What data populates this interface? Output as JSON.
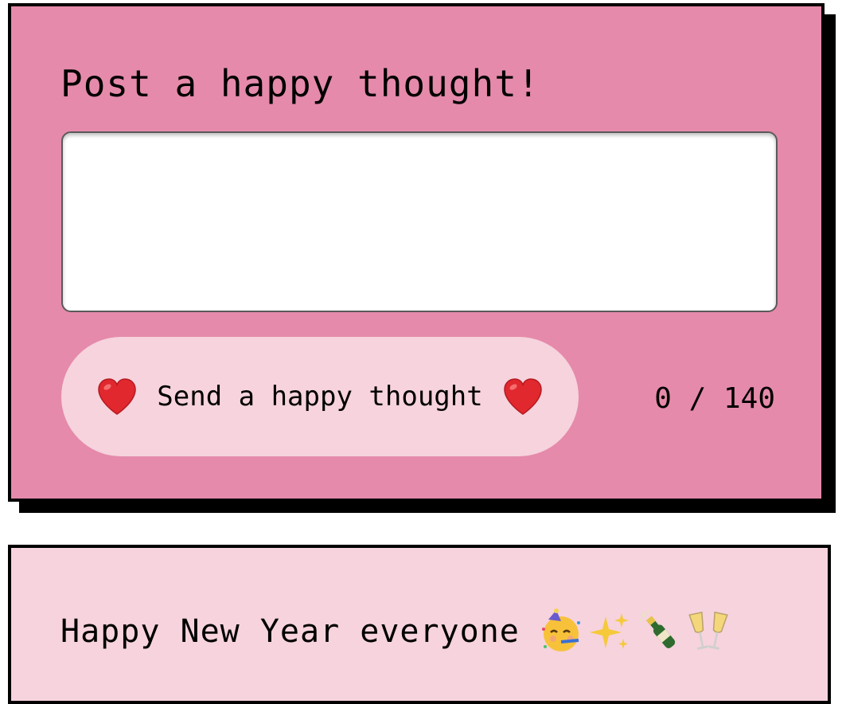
{
  "composer": {
    "title": "Post a happy thought!",
    "input": {
      "value": "",
      "placeholder": ""
    },
    "send_button": {
      "label": "Send a happy thought",
      "left_icon": "heart-icon",
      "right_icon": "heart-icon"
    },
    "counter": {
      "current": 0,
      "max": 140,
      "text": "0 / 140"
    }
  },
  "messages": [
    {
      "text": "Happy New Year everyone",
      "emojis": [
        "partying-face-icon",
        "sparkles-icon",
        "champagne-bottle-icon",
        "clinking-glasses-icon"
      ]
    }
  ],
  "colors": {
    "composer_bg": "#e58aaa",
    "button_bg": "#f6d3dd",
    "message_bg": "#f6d3dd",
    "border": "#000000",
    "heart": "#e0282e"
  }
}
